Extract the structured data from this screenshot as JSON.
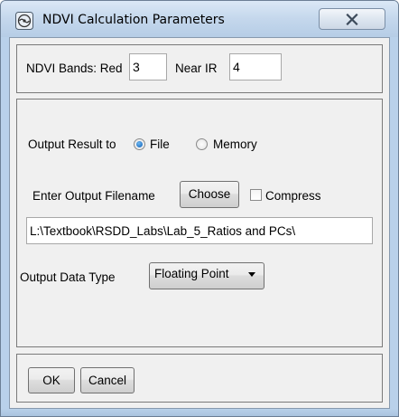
{
  "window": {
    "title": "NDVI Calculation Parameters",
    "close_icon": "close-x-icon",
    "app_icon": "dialog-app-icon"
  },
  "bands": {
    "label": "NDVI Bands: Red",
    "red_value": "3",
    "near_ir_label": "Near IR",
    "near_ir_value": "4"
  },
  "output": {
    "result_label": "Output Result to",
    "options": [
      {
        "label": "File",
        "selected": true
      },
      {
        "label": "Memory",
        "selected": false
      }
    ],
    "filename_label": "Enter Output Filename",
    "choose_label": "Choose",
    "compress_label": "Compress",
    "compress_checked": false,
    "filename_value": "L:\\Textbook\\RSDD_Labs\\Lab_5_Ratios and PCs\\",
    "data_type_label": "Output Data Type",
    "data_type_value": "Floating Point"
  },
  "buttons": {
    "ok": "OK",
    "cancel": "Cancel"
  },
  "colors": {
    "frame": "#b9d1ea",
    "client_bg": "#f0f0f0",
    "radio_selected": "#1f6fc2"
  }
}
